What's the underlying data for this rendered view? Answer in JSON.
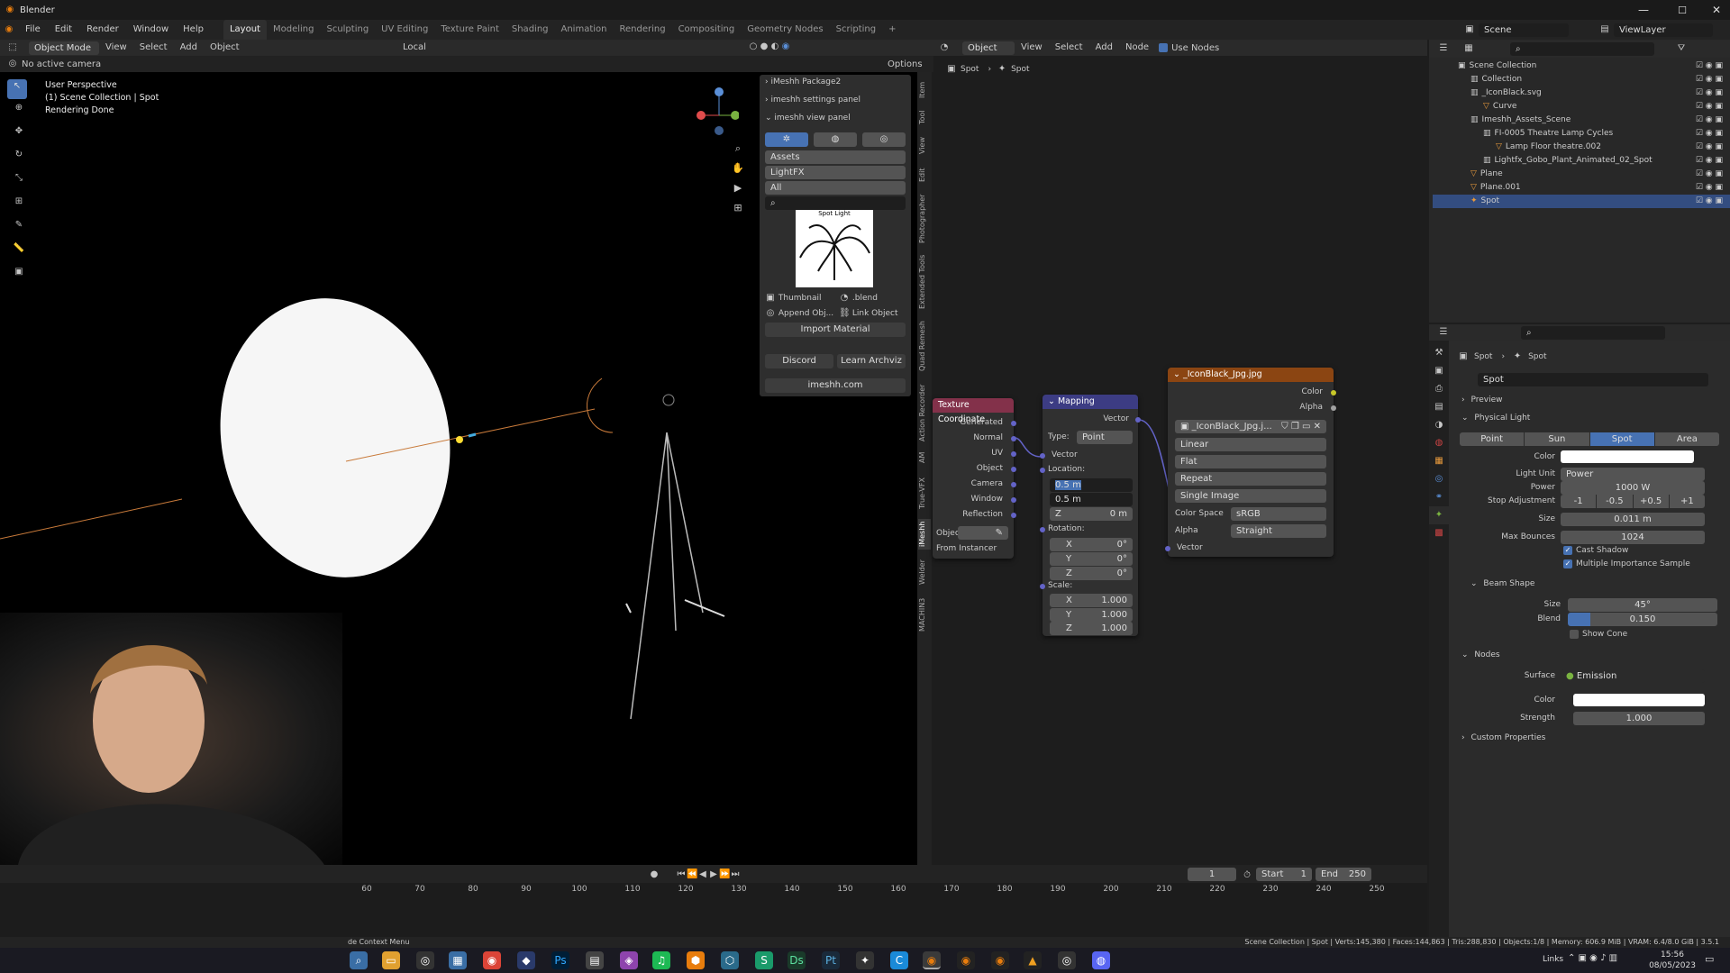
{
  "window": {
    "title": "Blender"
  },
  "menu": [
    "File",
    "Edit",
    "Render",
    "Window",
    "Help"
  ],
  "workspaces": [
    "Layout",
    "Modeling",
    "Sculpting",
    "UV Editing",
    "Texture Paint",
    "Shading",
    "Animation",
    "Rendering",
    "Compositing",
    "Geometry Nodes",
    "Scripting"
  ],
  "scene": {
    "label": "Scene",
    "view_layer": "ViewLayer"
  },
  "viewport": {
    "mode": "Object Mode",
    "menus": [
      "View",
      "Select",
      "Add",
      "Object"
    ],
    "orientation": "Local",
    "options": "Options",
    "camera": "No active camera",
    "overlay_text": [
      "User Perspective",
      "(1) Scene Collection | Spot",
      "Rendering Done"
    ]
  },
  "imeshh": {
    "package": "iMeshh Package2",
    "settings": "imeshh settings panel",
    "view": "imeshh view panel",
    "assets": "Assets",
    "category": "LightFX",
    "filter": "All",
    "thumb_title": "Spot Light",
    "thumbnail": "Thumbnail",
    "blend": ".blend",
    "append": "Append Obj...",
    "link": "Link Object",
    "import": "Import Material",
    "discord": "Discord",
    "learn": "Learn Archviz",
    "site": "imeshh.com"
  },
  "sidetabs": [
    "Item",
    "Tool",
    "View",
    "Edit",
    "Photographer",
    "Extended Tools",
    "Quad Remesh",
    "Action Recorder",
    "AM",
    "True-VFX",
    "iMeshh",
    "Welder",
    "MACHIN3"
  ],
  "node_editor": {
    "header": {
      "object": "Object",
      "menus": [
        "View",
        "Select",
        "Add",
        "Node"
      ],
      "use_nodes": "Use Nodes"
    },
    "breadcrumb": [
      "Spot",
      "Spot"
    ],
    "texcoord": {
      "title": "Texture Coordinate",
      "outputs": [
        "Generated",
        "Normal",
        "UV",
        "Object",
        "Camera",
        "Window",
        "Reflection"
      ],
      "object_label": "Object",
      "from_instancer": "From Instancer"
    },
    "mapping": {
      "title": "Mapping",
      "vector_out": "Vector",
      "type_label": "Type:",
      "type": "Point",
      "vector_in": "Vector",
      "location": "Location:",
      "loc_x": "0.5 m",
      "loc_y": "0.5 m",
      "loc_z_label": "Z",
      "loc_z": "0 m",
      "rotation": "Rotation:",
      "rot": [
        [
          "X",
          "0°"
        ],
        [
          "Y",
          "0°"
        ],
        [
          "Z",
          "0°"
        ]
      ],
      "scale": "Scale:",
      "scl": [
        [
          "X",
          "1.000"
        ],
        [
          "Y",
          "1.000"
        ],
        [
          "Z",
          "1.000"
        ]
      ]
    },
    "image": {
      "title": "_IconBlack_Jpg.jpg",
      "color": "Color",
      "alpha": "Alpha",
      "image_name": "_IconBlack_Jpg.j...",
      "interp": "Linear",
      "proj": "Flat",
      "ext": "Repeat",
      "source": "Single Image",
      "cs_label": "Color Space",
      "cs": "sRGB",
      "alpha_label": "Alpha",
      "alpha_mode": "Straight",
      "vector": "Vector"
    }
  },
  "timeline": {
    "ticks": [
      "60",
      "70",
      "80",
      "90",
      "100",
      "110",
      "120",
      "130",
      "140",
      "150",
      "160",
      "170",
      "180",
      "190",
      "200",
      "210",
      "220",
      "230",
      "240",
      "250"
    ],
    "current": "1",
    "start_label": "Start",
    "start": "1",
    "end_label": "End",
    "end": "250"
  },
  "outliner": {
    "items": [
      {
        "label": "Scene Collection",
        "indent": 0
      },
      {
        "label": "Collection",
        "indent": 1
      },
      {
        "label": "_IconBlack.svg",
        "indent": 1
      },
      {
        "label": "Curve",
        "indent": 2
      },
      {
        "label": "Imeshh_Assets_Scene",
        "indent": 1
      },
      {
        "label": "FI-0005 Theatre Lamp Cycles",
        "indent": 2
      },
      {
        "label": "Lamp Floor theatre.002",
        "indent": 3
      },
      {
        "label": "Lightfx_Gobo_Plant_Animated_02_Spot",
        "indent": 2
      },
      {
        "label": "Plane",
        "indent": 1
      },
      {
        "label": "Plane.001",
        "indent": 1
      },
      {
        "label": "Spot",
        "indent": 1
      }
    ]
  },
  "properties": {
    "breadcrumb": [
      "Spot",
      "Spot"
    ],
    "datablock": "Spot",
    "preview": "Preview",
    "physical": "Physical Light",
    "types": [
      "Point",
      "Sun",
      "Spot",
      "Area"
    ],
    "color_label": "Color",
    "unit_label": "Light Unit",
    "unit": "Power",
    "power_label": "Power",
    "power": "1000 W",
    "stop_label": "Stop Adjustment",
    "stops": [
      "-1",
      "-0.5",
      "+0.5",
      "+1"
    ],
    "size_label": "Size",
    "size": "0.011 m",
    "bounces_label": "Max Bounces",
    "bounces": "1024",
    "cast_shadow": "Cast Shadow",
    "mis": "Multiple Importance Sample",
    "beam": "Beam Shape",
    "beam_size_label": "Size",
    "beam_size": "45°",
    "blend_label": "Blend",
    "blend": "0.150",
    "show_cone": "Show Cone",
    "nodes": "Nodes",
    "surface_label": "Surface",
    "surface": "Emission",
    "ncolor_label": "Color",
    "strength_label": "Strength",
    "strength": "1.000",
    "custom": "Custom Properties"
  },
  "statusbar": {
    "context": "de Context Menu",
    "stats": "Scene Collection | Spot | Verts:145,380 | Faces:144,863 | Tris:288,830 | Objects:1/8 | Memory: 606.9 MiB | VRAM: 6.4/8.0 GiB | 3.5.1"
  },
  "taskbar": {
    "links": "Links",
    "time": "15:56",
    "date": "08/05/2023"
  }
}
